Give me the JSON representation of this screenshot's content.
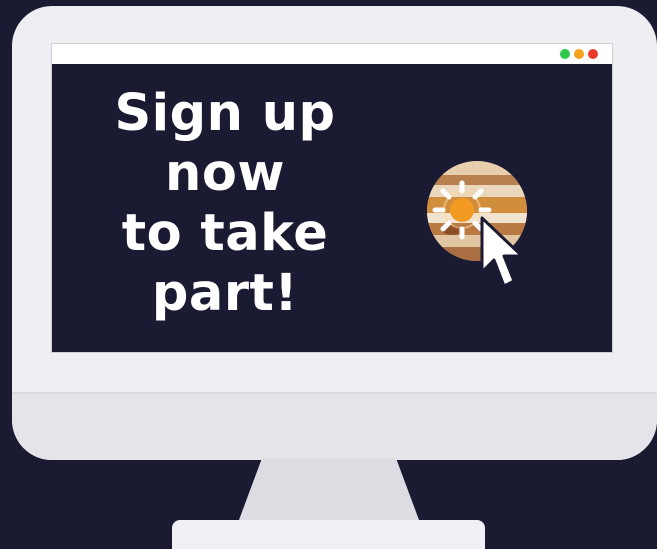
{
  "window": {
    "controls": [
      {
        "name": "green-dot",
        "color": "#2dc84c"
      },
      {
        "name": "orange-dot",
        "color": "#f2a21b"
      },
      {
        "name": "red-dot",
        "color": "#ea3a2b"
      }
    ]
  },
  "promo": {
    "headline_lines": [
      "Sign up",
      "now",
      "to take",
      "part!"
    ]
  },
  "icons": {
    "planet": "jupiter-planet-icon",
    "cursor": "mouse-pointer-icon"
  },
  "colors": {
    "background": "#1b1a33",
    "monitor": "#efeff3",
    "text": "#ffffff"
  }
}
